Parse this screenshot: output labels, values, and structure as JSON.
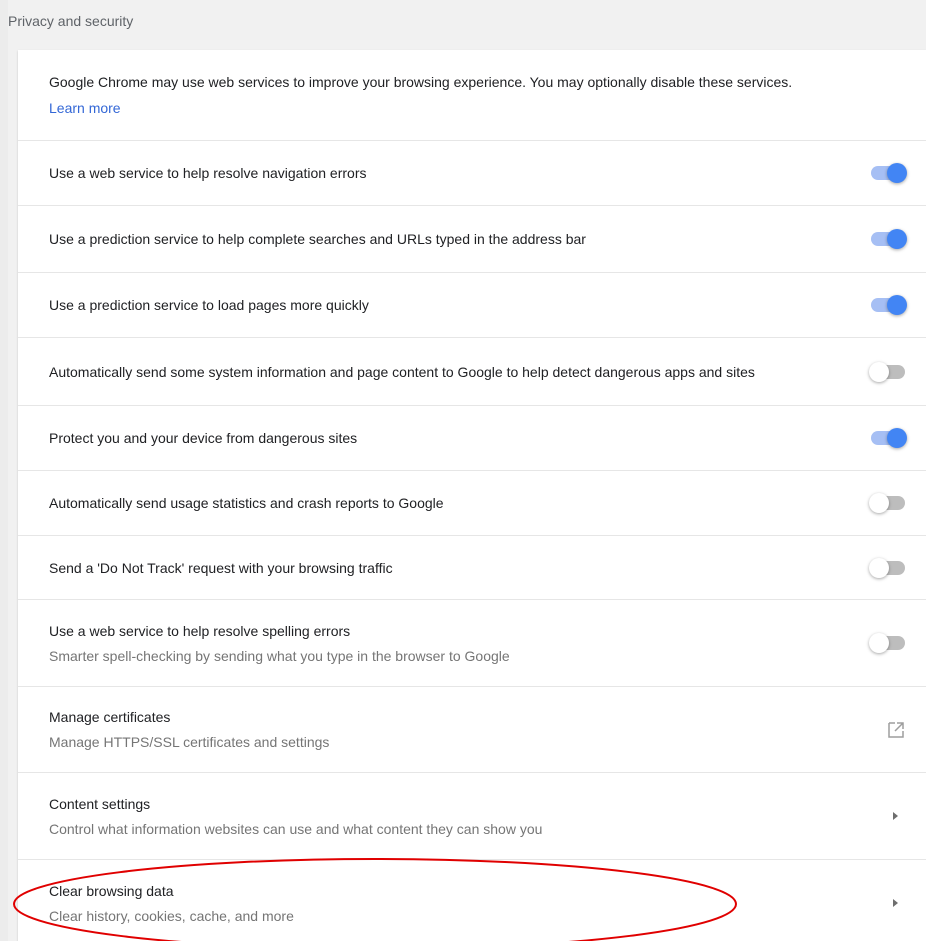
{
  "section": {
    "title": "Privacy and security"
  },
  "intro": {
    "text": "Google Chrome may use web services to improve your browsing experience. You may optionally disable these services.",
    "link": "Learn more"
  },
  "toggles": [
    {
      "label": "Use a web service to help resolve navigation errors",
      "state": "on"
    },
    {
      "label": "Use a prediction service to help complete searches and URLs typed in the address bar",
      "state": "on"
    },
    {
      "label": "Use a prediction service to load pages more quickly",
      "state": "on"
    },
    {
      "label": "Automatically send some system information and page content to Google to help detect dangerous apps and sites",
      "state": "off"
    },
    {
      "label": "Protect you and your device from dangerous sites",
      "state": "on"
    },
    {
      "label": "Automatically send usage statistics and crash reports to Google",
      "state": "off"
    },
    {
      "label": "Send a 'Do Not Track' request with your browsing traffic",
      "state": "off"
    },
    {
      "label": "Use a web service to help resolve spelling errors",
      "sublabel": "Smarter spell-checking by sending what you type in the browser to Google",
      "state": "off"
    }
  ],
  "links": [
    {
      "label": "Manage certificates",
      "sublabel": "Manage HTTPS/SSL certificates and settings",
      "icon": "open-in-new-icon"
    },
    {
      "label": "Content settings",
      "sublabel": "Control what information websites can use and what content they can show you",
      "icon": "arrow-right-icon"
    },
    {
      "label": "Clear browsing data",
      "sublabel": "Clear history, cookies, cache, and more",
      "icon": "arrow-right-icon"
    }
  ],
  "colors": {
    "toggle_on_knob": "#4285f4",
    "toggle_on_track": "#a6bff4",
    "toggle_off_knob": "#ffffff",
    "toggle_off_track": "#bdbdbd",
    "link": "#3367d6",
    "annotation": "#e00000"
  },
  "annotation": {
    "shape": "ellipse",
    "target": "Clear browsing data"
  }
}
